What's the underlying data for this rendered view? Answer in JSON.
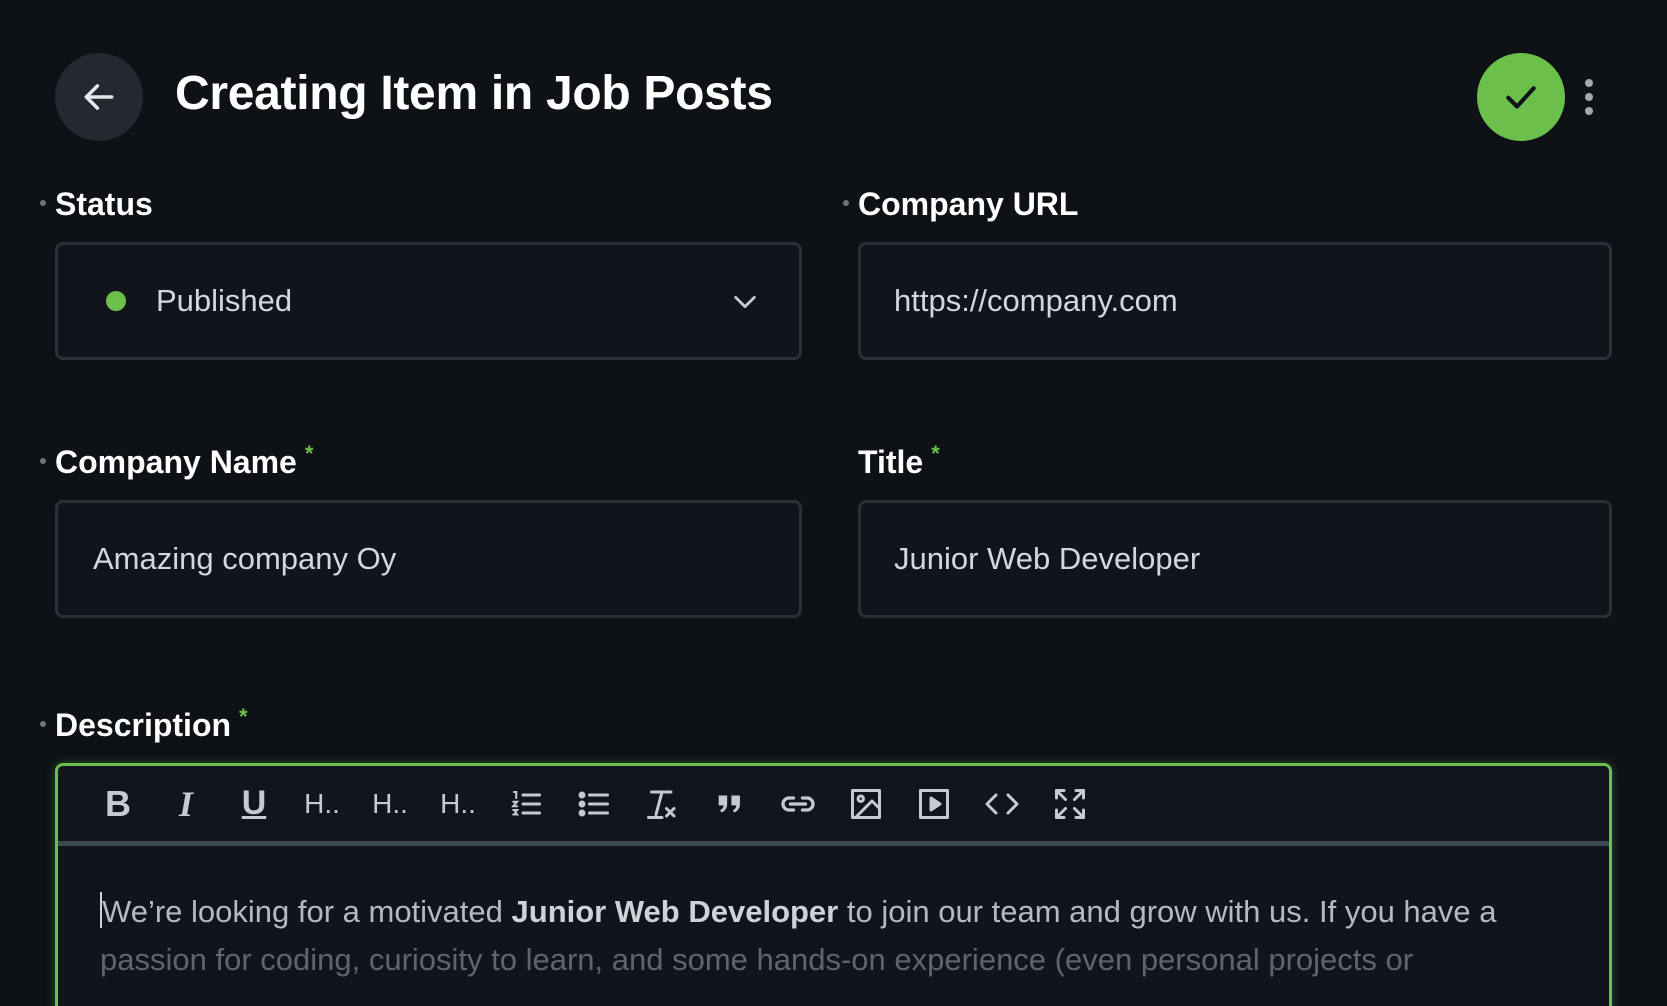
{
  "header": {
    "title": "Creating Item in Job Posts",
    "back_icon": "arrow-left-icon",
    "save_icon": "check-icon",
    "more_icon": "more-vertical-icon",
    "accent_color": "#6ac04b"
  },
  "fields": {
    "status": {
      "label": "Status",
      "value": "Published",
      "status_color": "#6ac04b"
    },
    "company_url": {
      "label": "Company URL",
      "value": "https://company.com"
    },
    "company_name": {
      "label": "Company Name",
      "value": "Amazing company Oy",
      "required": "*"
    },
    "title": {
      "label": "Title",
      "value": "Junior Web Developer",
      "required": "*"
    },
    "description": {
      "label": "Description",
      "required": "*",
      "text_before": "We’re looking for a motivated ",
      "text_bold": "Junior Web Developer",
      "text_after": " to join our team and grow with us. If you have a",
      "text_line2": "passion for coding, curiosity to learn, and some hands-on experience (even personal projects or"
    }
  },
  "toolbar": {
    "bold": "B",
    "italic": "I",
    "underline": "U",
    "h1": "H..",
    "h2": "H..",
    "h3": "H..",
    "icons": [
      "bold-icon",
      "italic-icon",
      "underline-icon",
      "heading-1-icon",
      "heading-2-icon",
      "heading-3-icon",
      "ordered-list-icon",
      "bullet-list-icon",
      "clear-format-icon",
      "quote-icon",
      "link-icon",
      "image-icon",
      "video-icon",
      "code-icon",
      "fullscreen-icon"
    ]
  }
}
